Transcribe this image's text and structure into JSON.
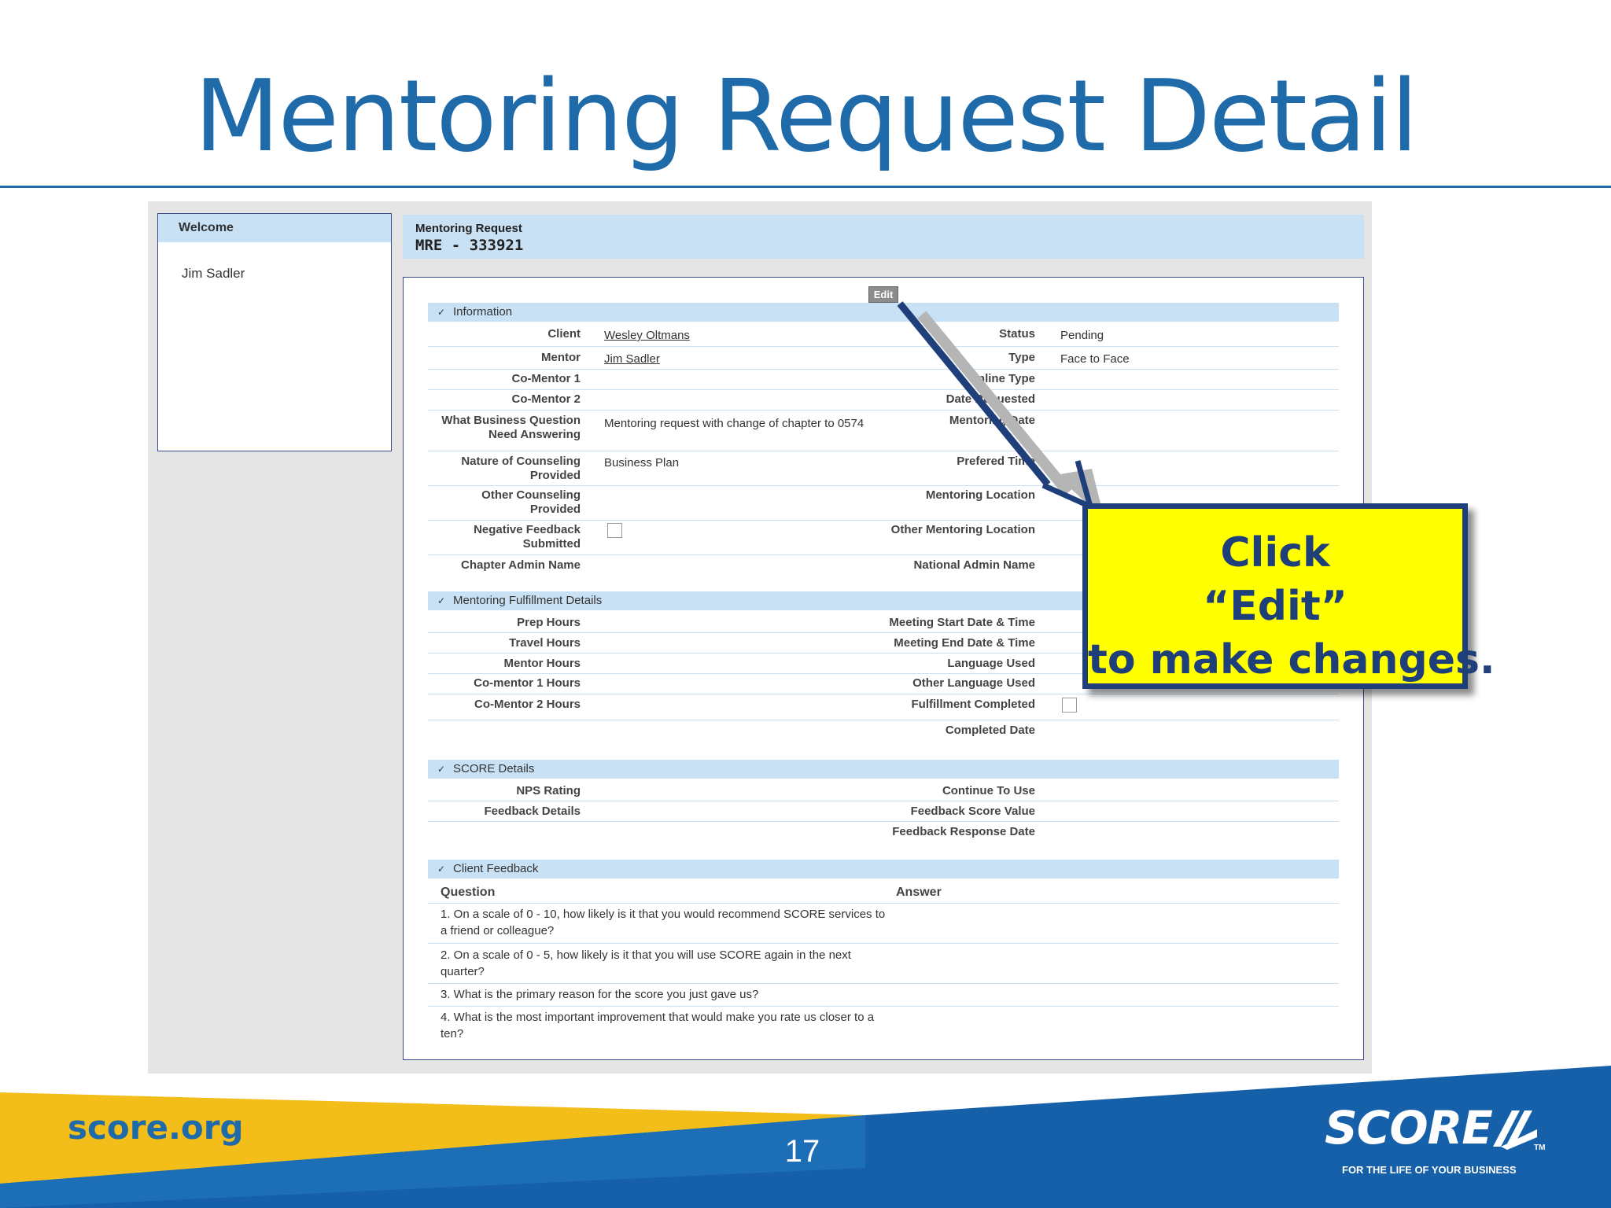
{
  "slide": {
    "title": "Mentoring Request Detail",
    "site": "score.org",
    "page_number": "17",
    "logo_text": "SCORE",
    "logo_tm": "TM",
    "tagline": "FOR THE LIFE OF YOUR BUSINESS"
  },
  "colors": {
    "title_blue": "#1f6aa9",
    "section_header": "#c9e1f4",
    "callout_fill": "#ffff00",
    "callout_border": "#1e3f7a",
    "footer_yellow": "#f3bd1a",
    "footer_blue": "#1560a8"
  },
  "welcome": {
    "header": "Welcome",
    "user": "Jim Sadler"
  },
  "request": {
    "label": "Mentoring Request",
    "id": "MRE - 333921"
  },
  "edit_button": "Edit",
  "information": {
    "title": "Information",
    "client_label": "Client",
    "client_value": "Wesley Oltmans",
    "status_label": "Status",
    "status_value": "Pending",
    "mentor_label": "Mentor",
    "mentor_value": "Jim Sadler",
    "type_label": "Type",
    "type_value": "Face to Face",
    "comentor1_label": "Co-Mentor 1",
    "online_type_label": "Online Type",
    "comentor2_label": "Co-Mentor 2",
    "date_requested_label": "Date Requested",
    "business_question_label": "What Business Question Need Answering",
    "business_question_value": "Mentoring request with change of chapter to 0574",
    "mentoring_date_label": "Mentoring Date",
    "nature_label": "Nature of Counseling Provided",
    "nature_value": "Business Plan",
    "prefered_time_label": "Prefered Time",
    "other_counseling_label": "Other Counseling Provided",
    "mentoring_location_label": "Mentoring Location",
    "negative_feedback_label": "Negative Feedback Submitted",
    "other_location_label": "Other Mentoring Location",
    "chapter_admin_label": "Chapter Admin Name",
    "national_admin_label": "National Admin Name"
  },
  "fulfillment": {
    "title": "Mentoring Fulfillment Details",
    "prep_hours": "Prep Hours",
    "travel_hours": "Travel Hours",
    "mentor_hours": "Mentor Hours",
    "comentor1_hours": "Co-mentor 1 Hours",
    "comentor2_hours": "Co-Mentor 2 Hours",
    "meeting_start": "Meeting Start Date & Time",
    "meeting_end": "Meeting End Date & Time",
    "language_used": "Language Used",
    "other_language": "Other Language Used",
    "fulfillment_completed": "Fulfillment Completed",
    "completed_date": "Completed Date"
  },
  "score_details": {
    "title": "SCORE Details",
    "nps_rating": "NPS Rating",
    "feedback_details": "Feedback Details",
    "continue_to_use": "Continue To Use",
    "feedback_score_value": "Feedback Score Value",
    "feedback_response_date": "Feedback Response Date"
  },
  "client_feedback": {
    "title": "Client Feedback",
    "question_header": "Question",
    "answer_header": "Answer",
    "questions": [
      "1. On a scale of 0 - 10, how likely is it that you would recommend SCORE services to a friend or colleague?",
      "2. On a scale of 0 - 5, how likely is it that you will use SCORE again in the next quarter?",
      "3. What is the primary reason for the score you just gave us?",
      "4. What is the most important improvement that would make you rate us closer to a ten?"
    ]
  },
  "callout": {
    "line1": "Click",
    "line2": "“Edit”",
    "line3": "to make changes."
  }
}
